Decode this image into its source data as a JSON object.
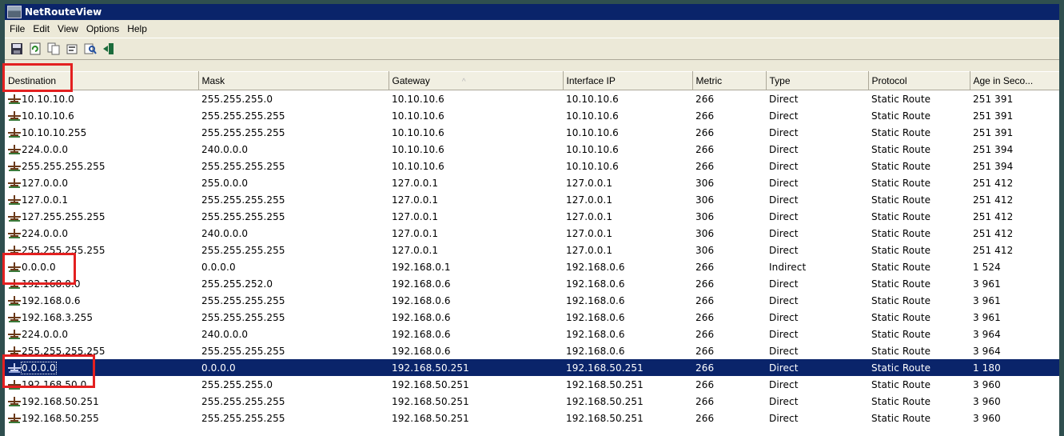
{
  "window": {
    "title": "NetRouteView"
  },
  "menu": [
    "File",
    "Edit",
    "View",
    "Options",
    "Help"
  ],
  "toolbar": [
    {
      "icon": "save-icon"
    },
    {
      "icon": "refresh-icon"
    },
    {
      "icon": "copy-icon"
    },
    {
      "icon": "properties-icon"
    },
    {
      "icon": "find-icon"
    },
    {
      "icon": "exit-icon"
    }
  ],
  "columns": [
    "Destination",
    "Mask",
    "Gateway",
    "Interface IP",
    "Metric",
    "Type",
    "Protocol",
    "Age in Seco..."
  ],
  "sort_indicator": "^",
  "rows": [
    [
      "10.10.10.0",
      "255.255.255.0",
      "10.10.10.6",
      "10.10.10.6",
      "266",
      "Direct",
      "Static Route",
      "251 391"
    ],
    [
      "10.10.10.6",
      "255.255.255.255",
      "10.10.10.6",
      "10.10.10.6",
      "266",
      "Direct",
      "Static Route",
      "251 391"
    ],
    [
      "10.10.10.255",
      "255.255.255.255",
      "10.10.10.6",
      "10.10.10.6",
      "266",
      "Direct",
      "Static Route",
      "251 391"
    ],
    [
      "224.0.0.0",
      "240.0.0.0",
      "10.10.10.6",
      "10.10.10.6",
      "266",
      "Direct",
      "Static Route",
      "251 394"
    ],
    [
      "255.255.255.255",
      "255.255.255.255",
      "10.10.10.6",
      "10.10.10.6",
      "266",
      "Direct",
      "Static Route",
      "251 394"
    ],
    [
      "127.0.0.0",
      "255.0.0.0",
      "127.0.0.1",
      "127.0.0.1",
      "306",
      "Direct",
      "Static Route",
      "251 412"
    ],
    [
      "127.0.0.1",
      "255.255.255.255",
      "127.0.0.1",
      "127.0.0.1",
      "306",
      "Direct",
      "Static Route",
      "251 412"
    ],
    [
      "127.255.255.255",
      "255.255.255.255",
      "127.0.0.1",
      "127.0.0.1",
      "306",
      "Direct",
      "Static Route",
      "251 412"
    ],
    [
      "224.0.0.0",
      "240.0.0.0",
      "127.0.0.1",
      "127.0.0.1",
      "306",
      "Direct",
      "Static Route",
      "251 412"
    ],
    [
      "255.255.255.255",
      "255.255.255.255",
      "127.0.0.1",
      "127.0.0.1",
      "306",
      "Direct",
      "Static Route",
      "251 412"
    ],
    [
      "0.0.0.0",
      "0.0.0.0",
      "192.168.0.1",
      "192.168.0.6",
      "266",
      "Indirect",
      "Static Route",
      "1 524"
    ],
    [
      "192.168.0.0",
      "255.255.252.0",
      "192.168.0.6",
      "192.168.0.6",
      "266",
      "Direct",
      "Static Route",
      "3 961"
    ],
    [
      "192.168.0.6",
      "255.255.255.255",
      "192.168.0.6",
      "192.168.0.6",
      "266",
      "Direct",
      "Static Route",
      "3 961"
    ],
    [
      "192.168.3.255",
      "255.255.255.255",
      "192.168.0.6",
      "192.168.0.6",
      "266",
      "Direct",
      "Static Route",
      "3 961"
    ],
    [
      "224.0.0.0",
      "240.0.0.0",
      "192.168.0.6",
      "192.168.0.6",
      "266",
      "Direct",
      "Static Route",
      "3 964"
    ],
    [
      "255.255.255.255",
      "255.255.255.255",
      "192.168.0.6",
      "192.168.0.6",
      "266",
      "Direct",
      "Static Route",
      "3 964"
    ],
    [
      "0.0.0.0",
      "0.0.0.0",
      "192.168.50.251",
      "192.168.50.251",
      "266",
      "Direct",
      "Static Route",
      "1 180"
    ],
    [
      "192.168.50.0",
      "255.255.255.0",
      "192.168.50.251",
      "192.168.50.251",
      "266",
      "Direct",
      "Static Route",
      "3 960"
    ],
    [
      "192.168.50.251",
      "255.255.255.255",
      "192.168.50.251",
      "192.168.50.251",
      "266",
      "Direct",
      "Static Route",
      "3 960"
    ],
    [
      "192.168.50.255",
      "255.255.255.255",
      "192.168.50.251",
      "192.168.50.251",
      "266",
      "Direct",
      "Static Route",
      "3 960"
    ]
  ],
  "selected_row": 16,
  "highlight_color": "#e32020",
  "selection_color": "#0a246a"
}
